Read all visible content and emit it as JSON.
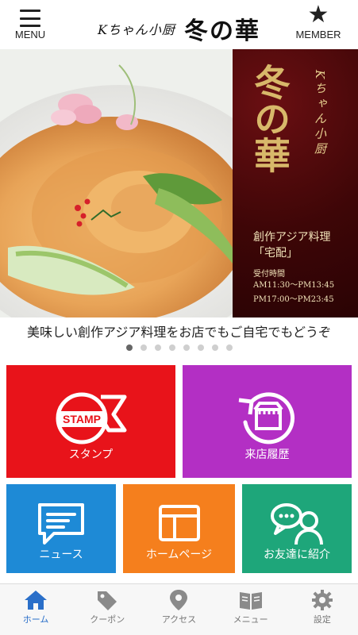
{
  "header": {
    "menu_label": "MENU",
    "member_label": "MEMBER",
    "logo_small": "Kちゃん小厨",
    "logo_big": "冬の華",
    "menu_icon": "hamburger-icon",
    "member_icon": "star-icon"
  },
  "hero": {
    "panel_title": "冬の華",
    "panel_sub": "Kちゃん小厨",
    "line1": "創作アジア料理",
    "line2": "「宅配」",
    "line3": "受付時間",
    "line4": "AM11:30〜PM13:45",
    "line5": "PM17:00〜PM23:45"
  },
  "caption": "美味しい創作アジア料理をお店でもご自宅でもどうぞ",
  "slider": {
    "count": 8,
    "active_index": 0
  },
  "tiles": [
    {
      "label": "スタンプ",
      "icon": "stamp-icon",
      "color": "#e8131a"
    },
    {
      "label": "来店履歴",
      "icon": "store-history-icon",
      "color": "#b32fc4"
    },
    {
      "label": "ニュース",
      "icon": "news-icon",
      "color": "#1e8ad6"
    },
    {
      "label": "ホームページ",
      "icon": "homepage-icon",
      "color": "#f57f1d"
    },
    {
      "label": "お友達に紹介",
      "icon": "friend-icon",
      "color": "#1ea67a"
    }
  ],
  "bottom_nav": [
    {
      "label": "ホーム",
      "icon": "home-icon",
      "active": true
    },
    {
      "label": "クーポン",
      "icon": "coupon-icon",
      "active": false
    },
    {
      "label": "アクセス",
      "icon": "location-pin-icon",
      "active": false
    },
    {
      "label": "メニュー",
      "icon": "menu-book-icon",
      "active": false
    },
    {
      "label": "設定",
      "icon": "gear-icon",
      "active": false
    }
  ],
  "colors": {
    "accent": "#2a6fc9",
    "nav_inactive": "#777777",
    "hero_panel": "#3e0607",
    "gold": "#d8b86a"
  }
}
